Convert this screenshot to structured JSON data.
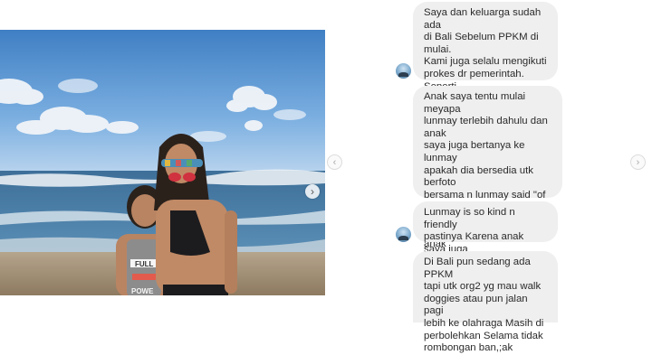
{
  "post": {
    "photo_alt": "Mother and daughter at the beach",
    "shirt_text": "FULL POWER",
    "next_icon": "chevron-right-icon"
  },
  "carousel": {
    "prev_icon": "chevron-left-icon",
    "next_icon": "chevron-right-icon"
  },
  "messages": [
    {
      "text": "Saya dan keluarga sudah ada\ndi Bali Sebelum PPKM di mulai.\nKami juga selalu mengikuti\nprokes dr pemerintah. Seperti\nKamu lihat ada tali masker yg\nmelingkar di leher anak saya."
    },
    {
      "text": "Anak saya tentu mulai meyapa\nlunmay terlebih dahulu dan anak\nsaya juga bertanya ke lunmay\napakah dia bersedia utk berfoto\nbersama n lunmay said \"of\ncourse\". Bahkan lunmay sempat\nberbincang ringan dengan anak\nsaya tentang doggies yg kita\nbawa (doggy terlihat di foto)"
    },
    {
      "text": "Lunmay is so kind n friendly\npastinya Karena anak saya juga\nsopan"
    },
    {
      "text": "Di Bali pun sedang ada PPKM\ntapi utk org2 yg mau walk\ndoggies atau pun jalan pagi\nlebih ke olahraga Masih di\nperbolehkan Selama tidak\nrombongan ban,;ak"
    }
  ]
}
